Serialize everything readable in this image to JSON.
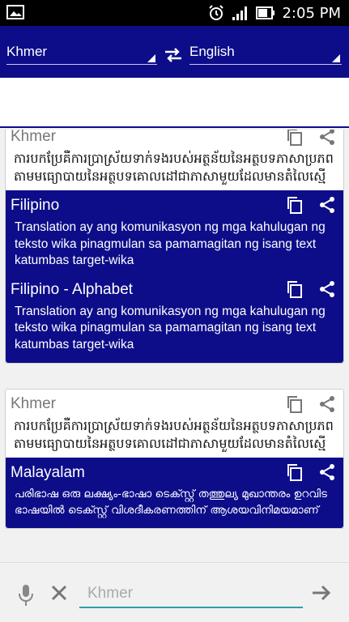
{
  "status_bar": {
    "time": "2:05 PM"
  },
  "app_bar": {
    "source_language": "Khmer",
    "target_language": "English"
  },
  "cards": [
    {
      "source_language": "Khmer",
      "source_text": "ការបកប្រែគឺការប្រាស្រ័យទាក់ទងរបស់អត្ថន័យនៃអត្ថបទភាសាប្រភពតាមមធ្យោបាយនៃអត្ថបទគោលដៅជាភាសាមួយដែលមានតំលៃស្មើ",
      "translations": [
        {
          "language": "Filipino",
          "text": "Translation ay ang komunikasyon ng mga kahulugan ng teksto wika pinagmulan sa pamamagitan ng isang text katumbas target-wika"
        },
        {
          "language": "Filipino - Alphabet",
          "text": "Translation ay ang komunikasyon ng mga kahulugan ng teksto wika pinagmulan sa pamamagitan ng isang text katumbas target-wika"
        }
      ]
    },
    {
      "source_language": "Khmer",
      "source_text": "ការបកប្រែគឺការប្រាស្រ័យទាក់ទងរបស់អត្ថន័យនៃអត្ថបទភាសាប្រភពតាមមធ្យោបាយនៃអត្ថបទគោលដៅជាភាសាមួយដែលមានតំលៃស្មើ",
      "translations": [
        {
          "language": "Malayalam",
          "text": "പരിഭാഷ ഒരു ലക്ഷ്യം-ഭാഷാ ടെക്സ്റ്റ് തത്തുല്യ മുഖാന്തരം ഉറവിട ഭാഷയിൽ ടെക്സ്റ്റ് വിശദീകരണത്തിന് ആശയവിനിമയമാണ്"
        }
      ]
    }
  ],
  "bottom_bar": {
    "input_placeholder": "Khmer"
  },
  "colors": {
    "primary": "#0d0d8a",
    "accent": "#2f9fa8"
  },
  "icons": [
    "gallery-icon",
    "alarm-icon",
    "signal-icon",
    "battery-icon",
    "swap-icon",
    "copy-icon",
    "share-icon",
    "microphone-icon",
    "clear-icon",
    "send-arrow-icon"
  ]
}
